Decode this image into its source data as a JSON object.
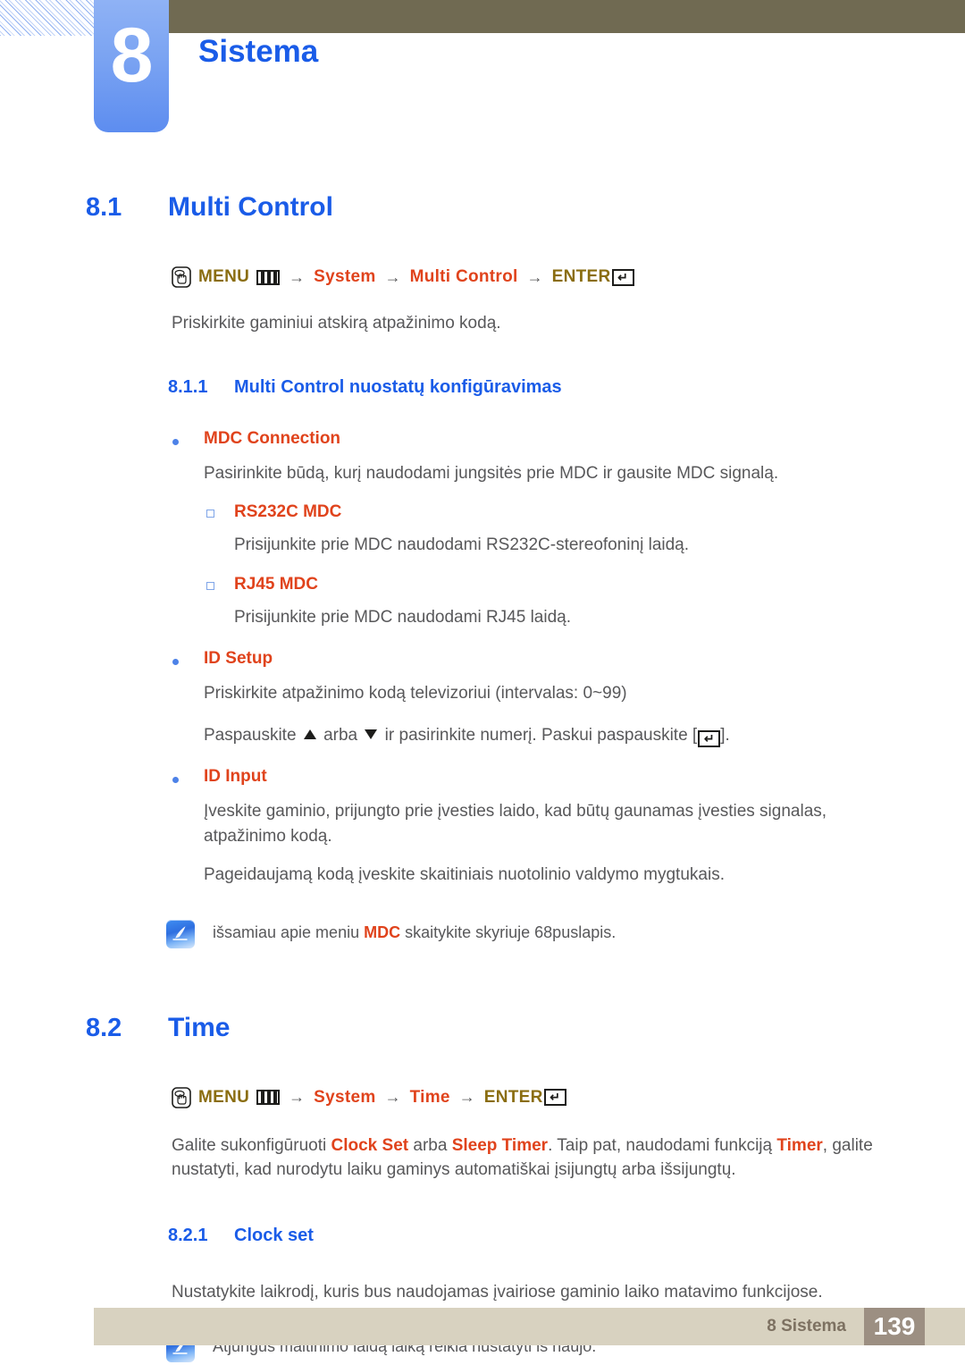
{
  "header": {
    "chapter_number": "8",
    "chapter_title": "Sistema"
  },
  "sections": {
    "s81": {
      "number": "8.1",
      "title": "Multi Control",
      "menu_path": {
        "menu_label": "MENU",
        "items": [
          "System",
          "Multi Control"
        ],
        "enter_label": "ENTER",
        "arrow": "→"
      },
      "intro": "Priskirkite gaminiui atskirą atpažinimo kodą."
    },
    "s811": {
      "number": "8.1.1",
      "title": "Multi Control nuostatų konfigūravimas",
      "b1_label": "MDC Connection",
      "b1_text": "Pasirinkite būdą, kurį naudodami jungsitės prie MDC ir gausite MDC signalą.",
      "b1_sub1_label": "RS232C MDC",
      "b1_sub1_text": "Prisijunkite prie MDC naudodami RS232C-stereofoninį laidą.",
      "b1_sub2_label": "RJ45 MDC",
      "b1_sub2_text": "Prisijunkite prie MDC naudodami RJ45 laidą.",
      "b2_label": "ID Setup",
      "b2_text1": "Priskirkite atpažinimo kodą televizoriui (intervalas: 0~99)",
      "b2_text2_a": "Paspauskite",
      "b2_text2_b": "arba",
      "b2_text2_c": "ir pasirinkite numerį. Paskui paspauskite [",
      "b2_text2_d": "].",
      "b3_label": "ID Input",
      "b3_text1": "Įveskite gaminio, prijungto prie įvesties laido, kad būtų gaunamas įvesties signalas, atpažinimo kodą.",
      "b3_text2": "Pageidaujamą kodą įveskite skaitiniais nuotolinio valdymo mygtukais.",
      "note_a": "išsamiau apie meniu",
      "note_hl": "MDC",
      "note_b": "skaitykite skyriuje 68puslapis."
    },
    "s82": {
      "number": "8.2",
      "title": "Time",
      "menu_path": {
        "menu_label": "MENU",
        "items": [
          "System",
          "Time"
        ],
        "enter_label": "ENTER",
        "arrow": "→"
      },
      "body_a": "Galite sukonfigūruoti",
      "body_hl1": "Clock Set",
      "body_b": "arba",
      "body_hl2": "Sleep Timer",
      "body_c": ". Taip pat, naudodami funkciją",
      "body_hl3": "Timer",
      "body_d": ", galite nustatyti, kad nurodytu laiku gaminys automatiškai įsijungtų arba išsijungtų."
    },
    "s821": {
      "number": "8.2.1",
      "title": "Clock set",
      "text": "Nustatykite laikrodį, kuris bus naudojamas įvairiose gaminio laiko matavimo funkcijose.",
      "note": "Atjungus maitinimo laidą laiką reikia nustatyti iš naujo."
    }
  },
  "footer": {
    "label": "8 Sistema",
    "page": "139"
  },
  "icons": {
    "hand_press": "hand-press-icon",
    "menu_bars": "menu-bars-icon",
    "enter_key": "enter-key-icon",
    "note": "note-pencil-icon"
  },
  "colors": {
    "heading_blue": "#1a5ce8",
    "accent_red": "#e0431c",
    "menu_gold": "#8a6d10",
    "body_gray": "#58585a",
    "tab_blue": "#7aa3f2",
    "olive": "#706a52",
    "footer_beige": "#d8d2c0",
    "footer_page_box": "#9c8f82"
  }
}
